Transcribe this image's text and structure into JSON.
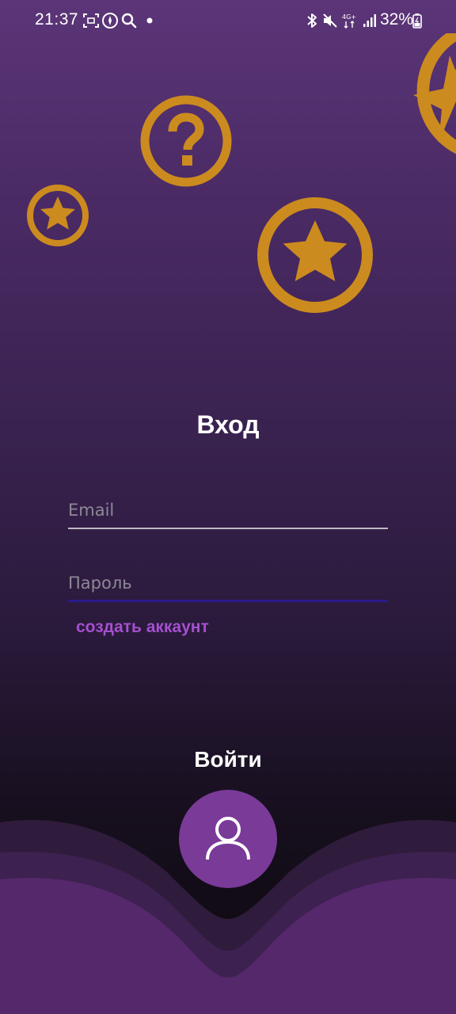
{
  "status_bar": {
    "time": "21:37",
    "battery": "32%",
    "icons": [
      "screenshot-icon",
      "compass-icon",
      "search-icon",
      "dot-icon",
      "bluetooth-icon",
      "mute-icon",
      "network-4g-icon",
      "signal-icon",
      "battery-icon"
    ]
  },
  "decorations": [
    "question-badge-icon",
    "star-badge-icon"
  ],
  "login_form": {
    "title": "Вход",
    "email_placeholder": "Email",
    "password_placeholder": "Пароль",
    "create_account_link": "создать аккаунт",
    "login_label": "Войти"
  },
  "colors": {
    "gold": "#cc8b1f",
    "accent_purple": "#7a3a98",
    "link_purple": "#a54fd0",
    "background_top": "#5b3578",
    "background_bottom": "#0b080d"
  }
}
